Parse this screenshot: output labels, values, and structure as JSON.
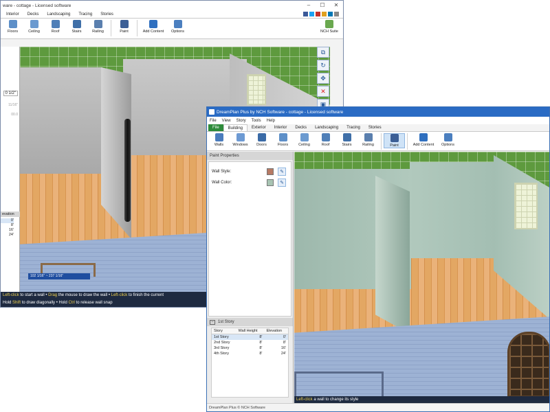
{
  "back": {
    "title": "ware - cottage - Licensed software",
    "tabs": [
      "Interior",
      "Decks",
      "Landscaping",
      "Tracing",
      "Stories"
    ],
    "toolbar": [
      "Floors",
      "Ceiling",
      "Roof",
      "Stairs",
      "Railing",
      "Paint",
      "Add Content",
      "Options"
    ],
    "nch_suite": "NCH Suite",
    "left_values": [
      "0 1/2\"",
      "11/16\"",
      "00.0"
    ],
    "table_header": "evation",
    "table_values": [
      "0'",
      "8'",
      "16'",
      "24'"
    ],
    "measure_label": "102 1/16\" ~ 237 1/16\"",
    "status": {
      "line1_parts": [
        "Left-click",
        " to start a wall • ",
        "Drag",
        " the mouse to draw the wall • ",
        "Left-click",
        " to finish the current"
      ],
      "line2_parts": [
        "Hold ",
        "Shift",
        " to draw diagonally • Hold ",
        "Ctrl",
        " to release wall snap"
      ]
    }
  },
  "front": {
    "title": "DreamPlan Plus by NCH Software - cottage - Licensed software",
    "menu": [
      "File",
      "View",
      "Story",
      "Tools",
      "Help"
    ],
    "tabs": [
      "File",
      "Building",
      "Exterior",
      "Interior",
      "Decks",
      "Landscaping",
      "Tracing",
      "Stories"
    ],
    "toolbar": [
      "Walls",
      "Windows",
      "Doors",
      "Floors",
      "Ceiling",
      "Roof",
      "Stairs",
      "Railing",
      "Paint",
      "Add Content",
      "Options"
    ],
    "paint_panel_title": "Paint Properties",
    "wall_style_label": "Wall Style:",
    "wall_color_label": "Wall Color:",
    "story_panel_title": "1st Story",
    "story_table": {
      "headers": [
        "Story",
        "Wall Height",
        "Elevation"
      ],
      "rows": [
        [
          "1st Story",
          "8'",
          "0'"
        ],
        [
          "2nd Story",
          "8'",
          "8'"
        ],
        [
          "3rd Story",
          "8'",
          "16'"
        ],
        [
          "4th Story",
          "8'",
          "24'"
        ]
      ]
    },
    "status_parts": [
      "Left-click",
      " a wall to change its style"
    ],
    "footer": "DreamPlan Plus © NCH Software"
  },
  "colors": {
    "file_tab": "#2e8b3a",
    "status_bar": "#1e2a40",
    "grass": "#5e9a3e",
    "wall_style_swatch": "#b77a64",
    "wall_color_swatch": "#a8c4b3"
  }
}
